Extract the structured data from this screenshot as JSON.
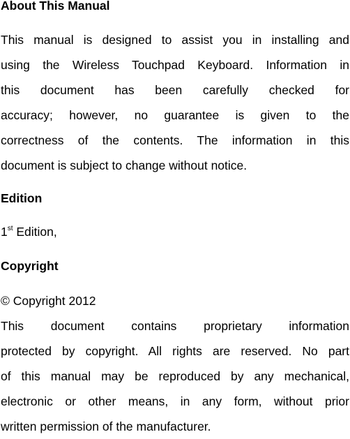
{
  "sections": [
    {
      "heading": "About This Manual",
      "lines": [
        "This manual is designed to assist you in installing and",
        "using the Wireless Touchpad Keyboard. Information in",
        "this document has been carefully checked for",
        "accuracy; however, no guarantee is given to the",
        "correctness of the contents. The information in this",
        "document is subject to change without notice."
      ]
    },
    {
      "heading": "Edition",
      "edition": {
        "number": "1",
        "suffix": "st",
        "text": " Edition,"
      }
    },
    {
      "heading": "Copyright",
      "notice": "© Copyright 2012",
      "lines": [
        "This document contains proprietary information",
        "protected by copyright. All rights are reserved. No part",
        "of this manual may be reproduced by any mechanical,",
        "electronic or other means, in any form, without prior",
        "written permission of the manufacturer."
      ]
    }
  ]
}
